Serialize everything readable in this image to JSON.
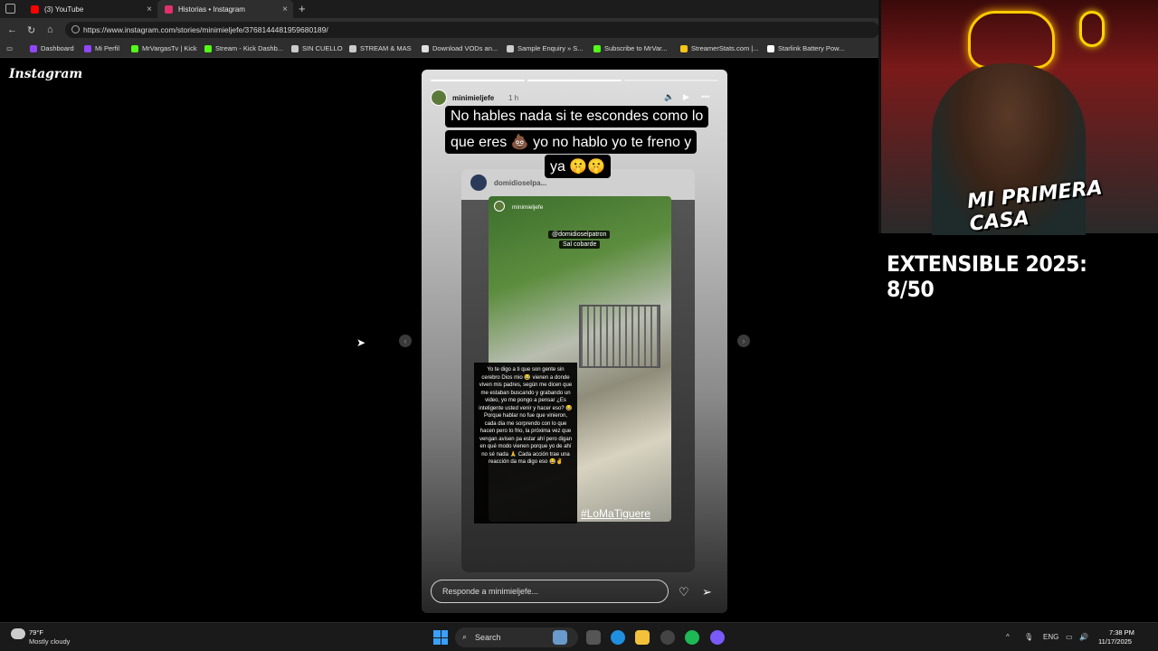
{
  "browser": {
    "tabs": [
      {
        "title": "(3) YouTube",
        "favicon_color": "#ff0000"
      },
      {
        "title": "Historias • Instagram",
        "favicon_color": "#e1306c"
      }
    ],
    "new_tab": "+",
    "close": "×",
    "url": "https://www.instagram.com/stories/minimieljefe/3768144481959680189/",
    "bookmarks": [
      {
        "label": "Dashboard",
        "color": "#9146ff"
      },
      {
        "label": "Mi Perfil",
        "color": "#9146ff"
      },
      {
        "label": "MrVargasTv | Kick",
        "color": "#53fc18"
      },
      {
        "label": "Stream - Kick Dashb...",
        "color": "#53fc18"
      },
      {
        "label": "SIN CUELLO",
        "color": "#cccccc"
      },
      {
        "label": "STREAM & MAS",
        "color": "#cccccc"
      },
      {
        "label": "Download VODs an...",
        "color": "#e0e0e0"
      },
      {
        "label": "Sample Enquiry » S...",
        "color": "#cccccc"
      },
      {
        "label": "Subscribe to MrVar...",
        "color": "#53fc18"
      },
      {
        "label": "StreamerStats.com |...",
        "color": "#f5c518"
      },
      {
        "label": "Starlink Battery Pow...",
        "color": "#ffffff"
      }
    ]
  },
  "instagram": {
    "logo": "Instagram",
    "story": {
      "username": "minimieljefe",
      "time": "1 h",
      "caption_lines": [
        "No hables nada si te escondes como lo",
        "que eres 💩 yo no hablo yo te freno y",
        "ya 🤫🤫"
      ],
      "repost_username": "domidioselpa...",
      "photo_username": "minimieljefe",
      "tag_line1": "@domidioselpatron",
      "tag_line2": "Sal cobarde",
      "overlay_text": "Yo te digo a ti que son gente sin cerebro Dios mio 😂 vienen a donde viven mis padres, según me dicen que me estaban buscando y grabando un video, yo me pongo a pensar ¿Es inteligente usted venir y hacer eso? 😂 Porque hablar no fue que vinieron, cada dia me sorprendo con lo que hacen pero to frio, la próxima vez que vengan avisen pa estar ahí pero digan en qué modo vienen porque yo de ahí no sé nada 🙏 Cada acción trae una reacción da ma digo eso 😂✌️",
      "hashtag": "#LoMaTiguere",
      "reply_placeholder": "Responde a minimieljefe...",
      "progress_segments": 3,
      "progress_done": 1
    }
  },
  "overlay": {
    "cam_logo": "MI PRIMERA CASA",
    "goal_text": "EXTENSIBLE 2025: 8/50"
  },
  "taskbar": {
    "weather_temp": "79°F",
    "weather_desc": "Mostly cloudy",
    "search_label": "Search",
    "lang": "ENG",
    "time": "7:38 PM",
    "date": "11/17/2025"
  }
}
